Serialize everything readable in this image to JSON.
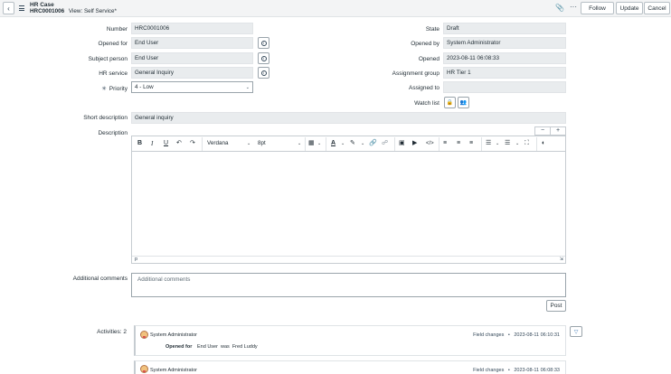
{
  "header": {
    "title": "HR Case",
    "number": "HRC0001006",
    "view": "View: Self Service*",
    "buttons": {
      "follow": "Follow",
      "update": "Update",
      "cancel": "Cancel"
    }
  },
  "form": {
    "left": {
      "number": {
        "label": "Number",
        "value": "HRC0001006"
      },
      "opened_for": {
        "label": "Opened for",
        "value": "End User"
      },
      "subject_person": {
        "label": "Subject person",
        "value": "End User"
      },
      "hr_service": {
        "label": "HR service",
        "value": "General Inquiry"
      },
      "priority": {
        "label": "Priority",
        "value": "4 - Low"
      }
    },
    "right": {
      "state": {
        "label": "State",
        "value": "Draft"
      },
      "opened_by": {
        "label": "Opened by",
        "value": "System Administrator"
      },
      "opened": {
        "label": "Opened",
        "value": "2023-08-11 06:08:33"
      },
      "assignment_group": {
        "label": "Assignment group",
        "value": "HR Tier 1"
      },
      "assigned_to": {
        "label": "Assigned to",
        "value": ""
      },
      "watch_list": {
        "label": "Watch list"
      }
    },
    "short_description": {
      "label": "Short description",
      "value": "General inquiry"
    },
    "description": {
      "label": "Description",
      "font": "Verdana",
      "size": "8pt",
      "status_path": "p"
    },
    "additional_comments": {
      "label": "Additional comments",
      "placeholder": "Additional comments"
    },
    "post_label": "Post"
  },
  "activities": {
    "label": "Activities: 2",
    "entries": [
      {
        "author": "System Administrator",
        "type": "Field changes",
        "timestamp": "2023-08-11 06:10:31",
        "field": "Opened for",
        "change": "End User  was  Fred Luddy"
      },
      {
        "author": "System Administrator",
        "type": "Field changes",
        "timestamp": "2023-08-11 06:08:33"
      }
    ]
  }
}
